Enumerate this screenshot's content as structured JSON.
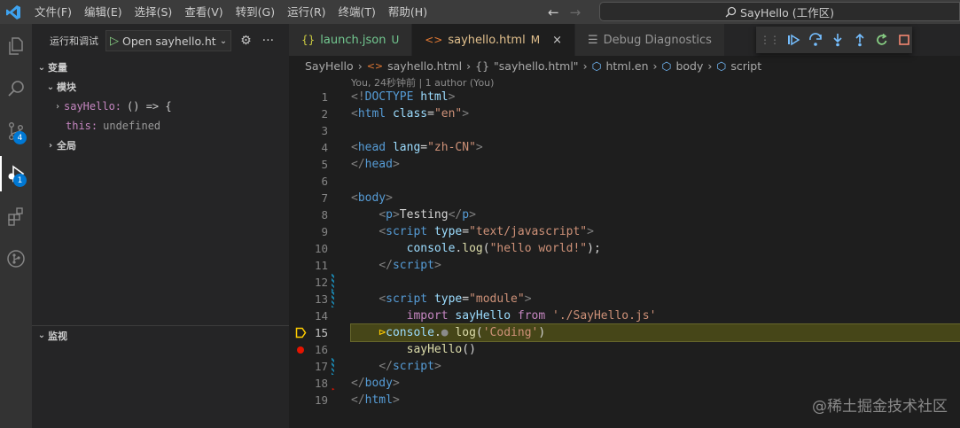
{
  "menu": [
    "文件(F)",
    "编辑(E)",
    "选择(S)",
    "查看(V)",
    "转到(G)",
    "运行(R)",
    "终端(T)",
    "帮助(H)"
  ],
  "command_center": "SayHello (工作区)",
  "activity_badges": {
    "source_control": "4",
    "debug": "1"
  },
  "sidebar": {
    "header": "运行和调试",
    "run_config": "Open sayhello.ht",
    "variables_label": "变量",
    "module_label": "模块",
    "var1_name": "sayHello:",
    "var1_value": "() => {",
    "var2_name": "this:",
    "var2_value": "undefined",
    "global_label": "全局",
    "watch_label": "监视"
  },
  "tabs": {
    "t1_label": "launch.json",
    "t1_status": "U",
    "t2_label": "sayhello.html",
    "t2_status": "M",
    "t3_label": "Debug Diagnostics"
  },
  "breadcrumbs": {
    "b1": "SayHello",
    "b2": "sayhello.html",
    "b3": "\"sayhello.html\"",
    "b4": "html.en",
    "b5": "body",
    "b6": "script"
  },
  "codelens": "You, 24秒钟前 | 1 author (You)",
  "current_line": 15,
  "breakpoint_line": 16,
  "watermark": "@稀土掘金技术社区",
  "colors": {
    "accent": "#0078d4",
    "breakpoint": "#e51400",
    "current_line": "#ffcc00"
  }
}
